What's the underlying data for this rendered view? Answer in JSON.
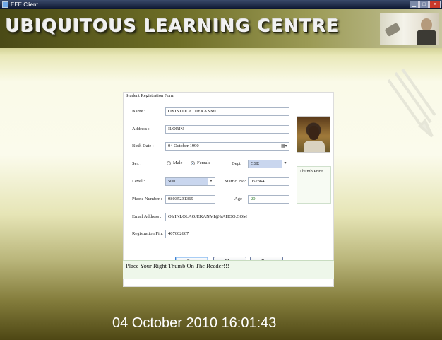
{
  "window": {
    "title": "EEE Client",
    "controls": {
      "minimize": "▁",
      "maximize": "□",
      "close": "✕"
    }
  },
  "banner": {
    "title": "UBIQUITOUS LEARNING CENTRE"
  },
  "form": {
    "legend": "Student Registration Form",
    "name": {
      "label": "Name :",
      "value": "OYINLOLA OJEKANMI"
    },
    "address": {
      "label": "Address :",
      "value": "ILORIN"
    },
    "birth_date": {
      "label": "Birth Date :",
      "value": "04  October  1990"
    },
    "sex": {
      "label": "Sex :",
      "options": [
        "Male",
        "Female"
      ],
      "selected": "Female"
    },
    "dept": {
      "label": "Dept:",
      "value": "CSE"
    },
    "level": {
      "label": "Level :",
      "value": "500"
    },
    "matric_no": {
      "label": "Matric. No:",
      "value": "052364"
    },
    "phone": {
      "label": "Phone Number :",
      "value": "08035231369"
    },
    "age": {
      "label": "Age :",
      "value": "20"
    },
    "email": {
      "label": "Email Address :",
      "value": "OYINLOLAOJEKANMI@YAHOO.COM"
    },
    "reg_pin": {
      "label": "Registration Pin:",
      "value": "407602667"
    },
    "thumb_label": "Thumb Print",
    "buttons": {
      "save": "Save",
      "clear": "Clear",
      "close": "Close"
    },
    "status": "Place Your Right Thumb On The Reader!!!"
  },
  "clock": "04 October 2010 16:01:43"
}
